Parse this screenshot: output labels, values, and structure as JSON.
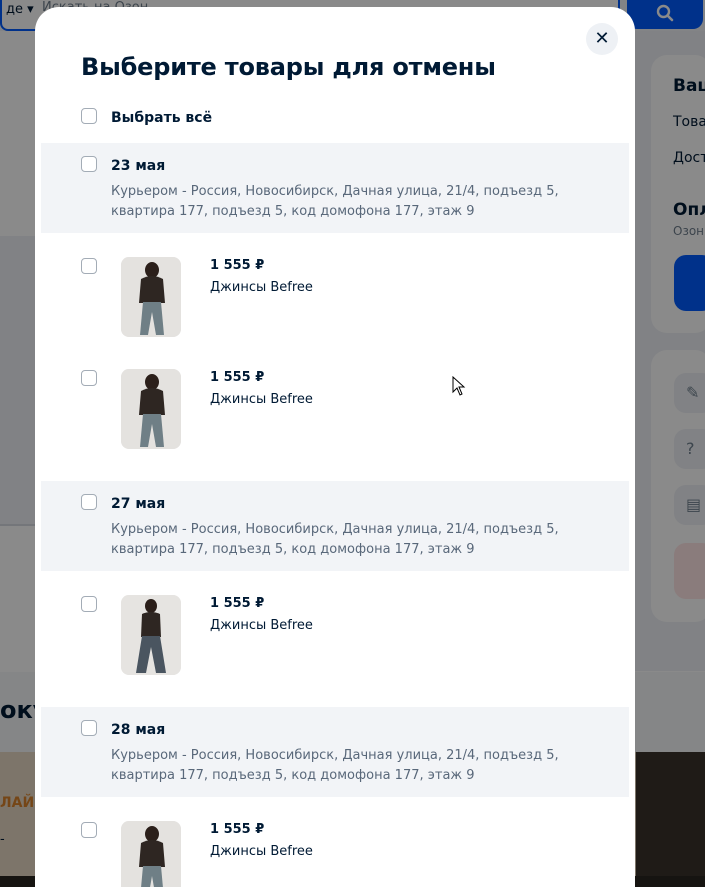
{
  "background": {
    "search_category": "де ▾",
    "search_placeholder": "Искать на Озон",
    "search_icon": "search-icon",
    "side_card": {
      "title_fragment": "Ваш",
      "row1": "Това",
      "row2": "Дост",
      "pay_title_fragment": "Опл",
      "pay_sub_fragment": "Озон"
    },
    "promo_title_fragment": "оку",
    "promo_logo_fragment": "ЛАЙ",
    "promo_dash": "-"
  },
  "modal": {
    "title": "Выберите товары для отмены",
    "close_icon": "close-icon",
    "select_all_label": "Выбрать всё",
    "groups": [
      {
        "date": "23 мая",
        "address": "Курьером - Россия, Новосибирск, Дачная улица, 21/4, подъезд 5, квартира 177, подъезд 5, код домофона 177, этаж 9",
        "items": [
          {
            "price": "1 555 ₽",
            "name": "Джинсы Befree"
          },
          {
            "price": "1 555 ₽",
            "name": "Джинсы Befree"
          }
        ]
      },
      {
        "date": "27 мая",
        "address": "Курьером - Россия, Новосибирск, Дачная улица, 21/4, подъезд 5, квартира 177, подъезд 5, код домофона 177, этаж 9",
        "items": [
          {
            "price": "1 555 ₽",
            "name": "Джинсы Befree"
          }
        ]
      },
      {
        "date": "28 мая",
        "address": "Курьером - Россия, Новосибирск, Дачная улица, 21/4, подъезд 5, квартира 177, подъезд 5, код домофона 177, этаж 9",
        "items": [
          {
            "price": "1 555 ₽",
            "name": "Джинсы Befree"
          }
        ]
      }
    ]
  },
  "colors": {
    "accent": "#005bff",
    "text_primary": "#001a34",
    "text_secondary": "#59687a",
    "group_band": "#f2f4f7"
  }
}
